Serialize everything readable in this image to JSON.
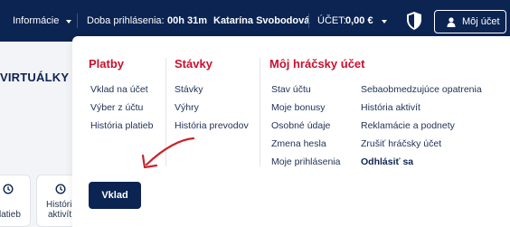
{
  "header": {
    "info_menu": "Informácie",
    "login_time_label": "Doba prihlásenia:",
    "login_time_value": "00h 31m",
    "user_name": "Katarína Svobodová",
    "account_label": "ÚČET:",
    "account_balance": "0,00 €",
    "my_account_button": "Môj účet"
  },
  "background": {
    "section_title": "VIRTUÁLKY",
    "card1_text": "latieb",
    "card2_text_line1": "História",
    "card2_text_line2": "aktivít"
  },
  "dropdown": {
    "columns": [
      {
        "title": "Platby",
        "links": [
          "Vklad na účet",
          "Výber z účtu",
          "História platieb"
        ]
      },
      {
        "title": "Stávky",
        "links": [
          "Stávky",
          "Výhry",
          "História prevodov"
        ]
      },
      {
        "title": "Môj hráčsky účet",
        "links": [
          "Stav účtu",
          "Moje bonusy",
          "Osobné údaje",
          "Zmena hesla",
          "Moje prihlásenia"
        ],
        "links_right": [
          "Sebaobmedzujúce opatrenia",
          "História aktivít",
          "Reklamácie a podnety",
          "Zrušiť hráčsky účet",
          "Odhlásiť sa"
        ]
      }
    ],
    "deposit_button": "Vklad"
  },
  "colors": {
    "navy": "#0c2452",
    "red": "#c8102e",
    "annotation_arrow": "#c8242b"
  },
  "icons": [
    "caret-down-icon",
    "shield-icon",
    "user-icon",
    "history-icon",
    "annotation-arrow"
  ]
}
